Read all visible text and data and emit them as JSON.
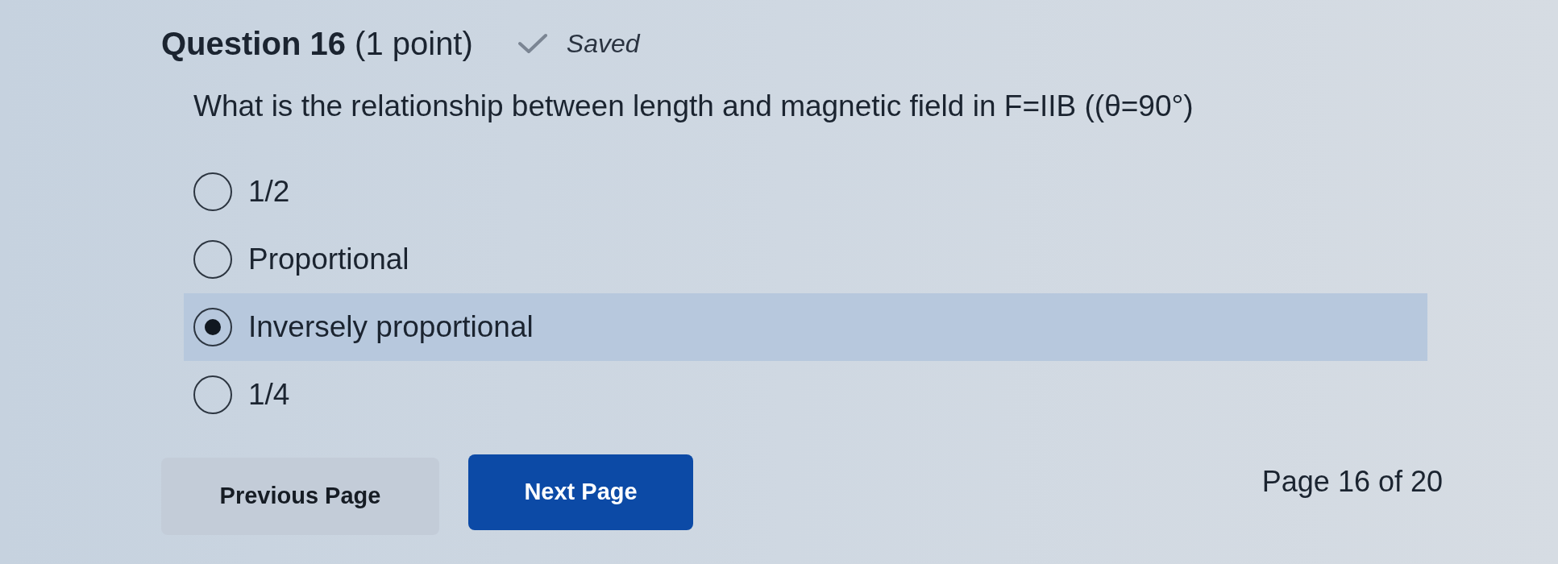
{
  "question": {
    "title": "**Question 16** (1 point)",
    "status": {
      "kind": "saved",
      "label": "Saved"
    },
    "prompt": "What is the relationship between length and magnetic field in F=IIB ((θ=90°)"
  },
  "options": [
    {
      "label": "1/2",
      "selected": false
    },
    {
      "label": "Proportional",
      "selected": false
    },
    {
      "label": "Inversely proportional",
      "selected": true
    },
    {
      "label": "1/4",
      "selected": false
    }
  ],
  "navigation": {
    "buttons": [
      {
        "kind": "secondary",
        "label": "Previous Page"
      },
      {
        "kind": "primary",
        "label": "Next Page"
      }
    ],
    "page_indicator": "Page 16 of 20"
  }
}
